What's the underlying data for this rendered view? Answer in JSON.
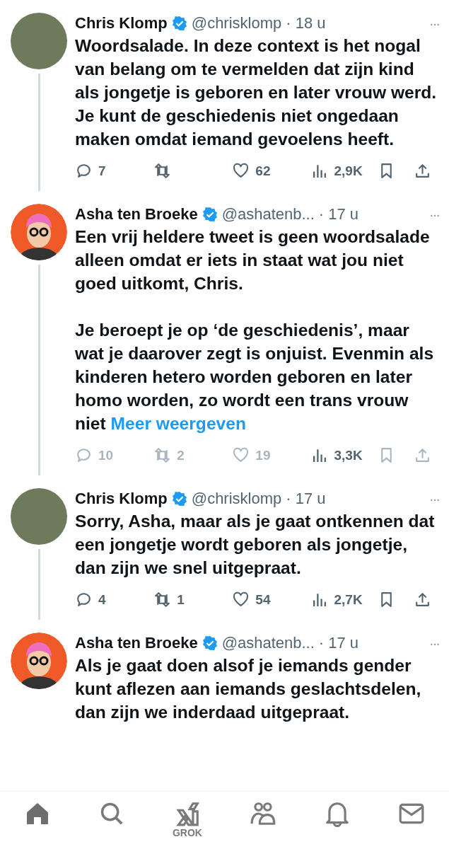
{
  "tweets": [
    {
      "avatar": {
        "kind": "photo"
      },
      "name": "Chris Klomp",
      "verified": true,
      "handle": "@chrisklomp",
      "time": "· 18 u",
      "more": "···",
      "text": "Woordsalade. In deze context is het nogal van belang om te vermelden dat zijn kind als jongetje is geboren en later vrouw werd. Je kunt de geschiedenis niet ongedaan maken omdat iemand gevoelens heeft.",
      "actions": [
        {
          "kind": "reply",
          "count": "7",
          "dimmed": false
        },
        {
          "kind": "repost",
          "dimmed": false
        },
        {
          "kind": "like",
          "count": "62",
          "dimmed": false
        },
        {
          "kind": "views",
          "count": "2,9K",
          "dimmed": false
        },
        {
          "kind": "bookmark",
          "dimmed": false
        },
        {
          "kind": "share",
          "dimmed": false
        }
      ]
    },
    {
      "avatar": {
        "kind": "cartoon"
      },
      "name": "Asha ten Broeke",
      "verified": true,
      "handle": "@ashatenb...",
      "time": "· 17 u",
      "more": "···",
      "text": "Een vrij heldere tweet is geen woordsalade alleen omdat er iets in staat wat jou niet goed uitkomt, Chris.\n\nJe beroept je op ‘de geschiedenis’, maar wat je daarover zegt is onjuist. Evenmin als kinderen hetero worden geboren en later homo worden, zo wordt een trans vrouw niet",
      "more_link": "Meer weergeven",
      "actions": [
        {
          "kind": "reply",
          "count": "10",
          "dimmed": true
        },
        {
          "kind": "repost",
          "count": "2",
          "dimmed": true
        },
        {
          "kind": "like",
          "count": "19",
          "dimmed": true
        },
        {
          "kind": "views",
          "count": "3,3K",
          "dimmed": false
        },
        {
          "kind": "bookmark",
          "dimmed": true
        },
        {
          "kind": "share",
          "dimmed": true
        }
      ]
    },
    {
      "avatar": {
        "kind": "photo"
      },
      "name": "Chris Klomp",
      "verified": true,
      "handle": "@chrisklomp",
      "time": "· 17 u",
      "more": "···",
      "text": "Sorry, Asha, maar als je gaat ontkennen dat een jongetje wordt geboren als jongetje, dan zijn we snel uitgepraat.",
      "actions": [
        {
          "kind": "reply",
          "count": "4",
          "dimmed": false
        },
        {
          "kind": "repost",
          "count": "1",
          "dimmed": false
        },
        {
          "kind": "like",
          "count": "54",
          "dimmed": false
        },
        {
          "kind": "views",
          "count": "2,7K",
          "dimmed": false
        },
        {
          "kind": "bookmark",
          "dimmed": false
        },
        {
          "kind": "share",
          "dimmed": false
        }
      ]
    },
    {
      "avatar": {
        "kind": "cartoon"
      },
      "name": "Asha ten Broeke",
      "verified": true,
      "handle": "@ashatenb...",
      "time": "· 17 u",
      "more": "···",
      "text": "Als je gaat doen alsof je iemands gender kunt aflezen aan iemands geslachtsdelen, dan zijn we inderdaad uitgepraat."
    }
  ],
  "nav": [
    {
      "kind": "home",
      "selected": true
    },
    {
      "kind": "search",
      "selected": false
    },
    {
      "kind": "grok",
      "label": "GROK",
      "selected": false
    },
    {
      "kind": "people",
      "selected": false
    },
    {
      "kind": "bell",
      "selected": false
    },
    {
      "kind": "mail",
      "selected": false
    }
  ]
}
